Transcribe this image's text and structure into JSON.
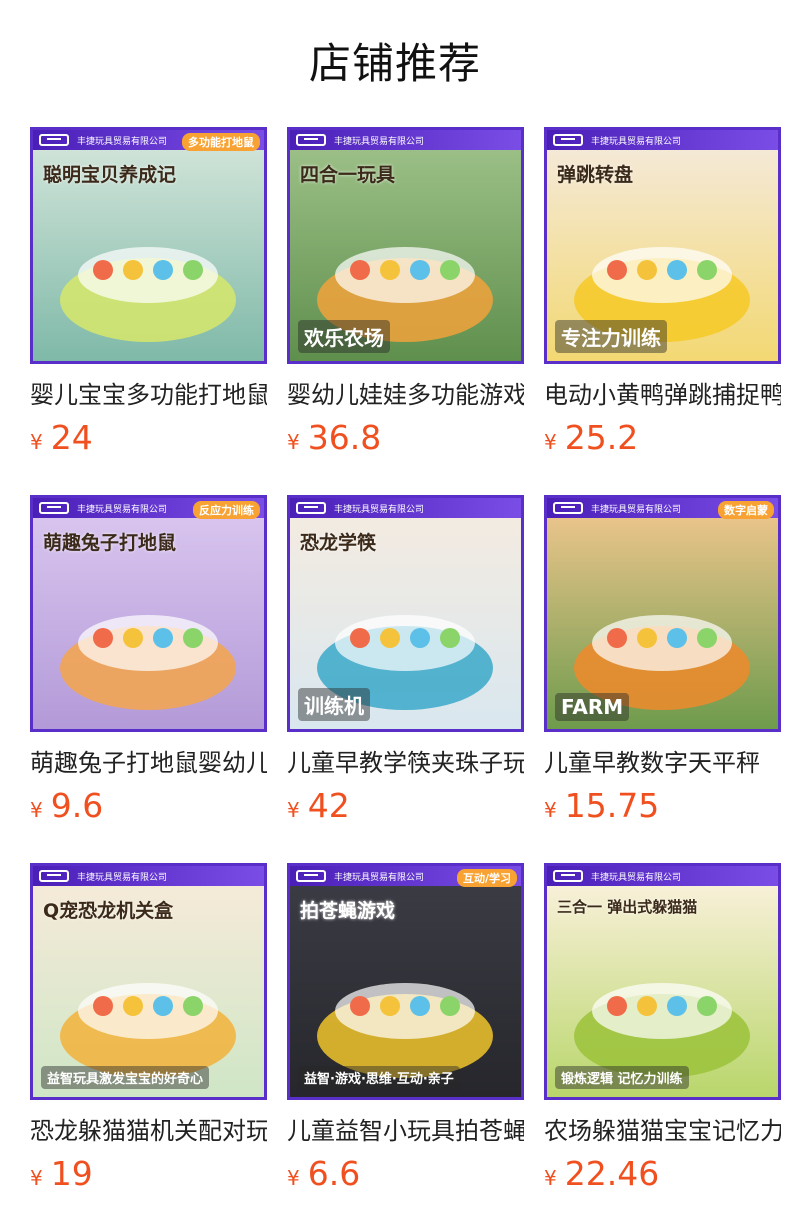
{
  "page": {
    "title": "店铺推荐"
  },
  "brand": {
    "shop_name": "丰捷玩具贸易有限公司"
  },
  "colors": {
    "thumb_border": "#5a2fc9",
    "price": "#f0501f",
    "text": "#222222"
  },
  "products": [
    {
      "name": "婴儿宝宝多功能打地鼠",
      "currency": "¥",
      "price": "24",
      "image": {
        "tag": "多功能打地鼠",
        "headline": "聪明宝贝养成记",
        "subline": "",
        "bg_top": "#cfe3d8",
        "bg_bottom": "#7fb9a8",
        "accent": "#d7e86a"
      }
    },
    {
      "name": "婴幼儿娃娃多功能游戏",
      "currency": "¥",
      "price": "36.8",
      "image": {
        "tag": "",
        "headline": "四合一玩具",
        "subline": "欢乐农场",
        "bg_top": "#9bbf86",
        "bg_bottom": "#5f8f4d",
        "accent": "#f2a23b"
      }
    },
    {
      "name": "电动小黄鸭弹跳捕捉鸭",
      "currency": "¥",
      "price": "25.2",
      "image": {
        "tag": "",
        "headline": "弹跳转盘",
        "subline": "专注力训练",
        "bg_top": "#f4e9d6",
        "bg_bottom": "#f3d873",
        "accent": "#f6c926"
      }
    },
    {
      "name": "萌趣兔子打地鼠婴幼儿",
      "currency": "¥",
      "price": "9.6",
      "image": {
        "tag": "反应力训练",
        "headline": "萌趣兔子打地鼠",
        "subline": "",
        "bg_top": "#d8c4ee",
        "bg_bottom": "#b39ad8",
        "accent": "#f5a44b"
      }
    },
    {
      "name": "儿童早教学筷夹珠子玩具",
      "currency": "¥",
      "price": "42",
      "image": {
        "tag": "",
        "headline": "恐龙学筷",
        "subline": "训练机",
        "bg_top": "#f3ebe1",
        "bg_bottom": "#d9e7ef",
        "accent": "#3aa8c9"
      }
    },
    {
      "name": "儿童早教数字天平秤",
      "currency": "¥",
      "price": "15.75",
      "image": {
        "tag": "数字启蒙",
        "headline": "",
        "subline": "FARM",
        "bg_top": "#e9c48a",
        "bg_bottom": "#6e9b4c",
        "accent": "#f08a2b"
      }
    },
    {
      "name": "恐龙躲猫猫机关配对玩具",
      "currency": "¥",
      "price": "19",
      "image": {
        "tag": "",
        "headline": "Q宠恐龙机关盒",
        "subline": "益智玩具激发宝宝的好奇心",
        "bg_top": "#f5ead8",
        "bg_bottom": "#cfe6c6",
        "accent": "#f2b23a"
      }
    },
    {
      "name": "儿童益智小玩具拍苍蝇",
      "currency": "¥",
      "price": "6.6",
      "image": {
        "tag": "互动/学习",
        "headline": "拍苍蝇游戏",
        "subline": "益智·游戏·思维·互动·亲子",
        "bg_top": "#3b3b44",
        "bg_bottom": "#26262c",
        "accent": "#f1c62c"
      }
    },
    {
      "name": "农场躲猫猫宝宝记忆力",
      "currency": "¥",
      "price": "22.46",
      "image": {
        "tag": "",
        "headline": "三合一  弹出式躲猫猫",
        "subline": "锻炼逻辑 记忆力训练",
        "bg_top": "#f8f0d8",
        "bg_bottom": "#b9d66b",
        "accent": "#9bc23a"
      }
    }
  ]
}
